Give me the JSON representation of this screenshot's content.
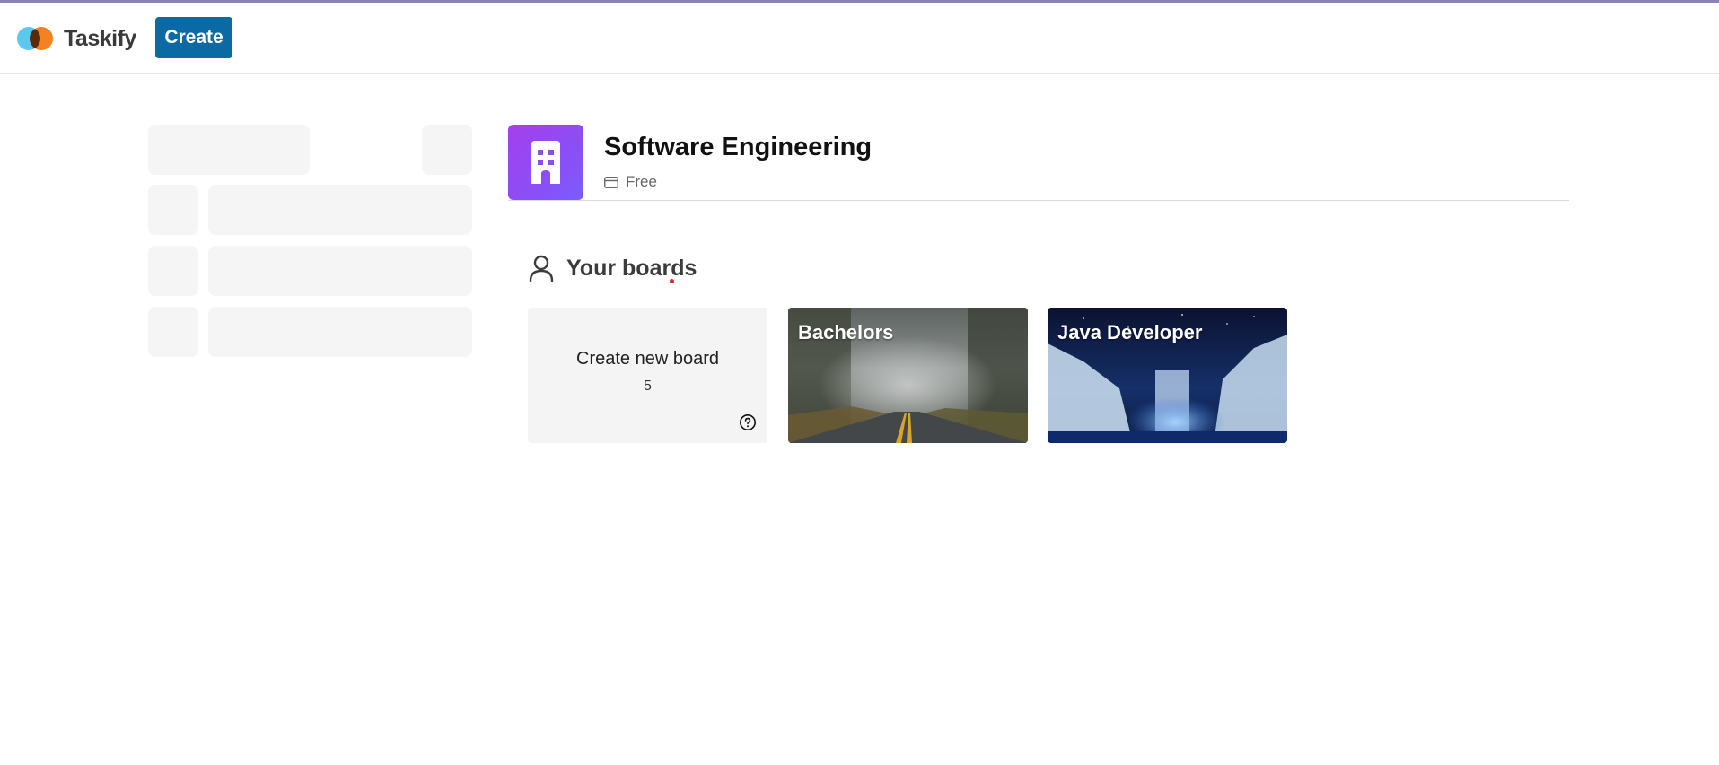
{
  "app": {
    "name": "Taskify",
    "create_label": "Create"
  },
  "organization": {
    "name": "Software Engineering",
    "plan": "Free",
    "avatar_icon": "building-icon",
    "accent_color": "#a53fec"
  },
  "boards_section": {
    "heading": "Your boards",
    "create_card": {
      "label": "Create new board",
      "remaining": "5",
      "help_icon": "help-circle-icon"
    },
    "boards": [
      {
        "title": "Bachelors",
        "image": "misty forest road"
      },
      {
        "title": "Java Developer",
        "image": "frozen waterfall at night"
      }
    ]
  },
  "colors": {
    "primary_button": "#0b69a3",
    "skeleton": "#f5f5f5"
  }
}
